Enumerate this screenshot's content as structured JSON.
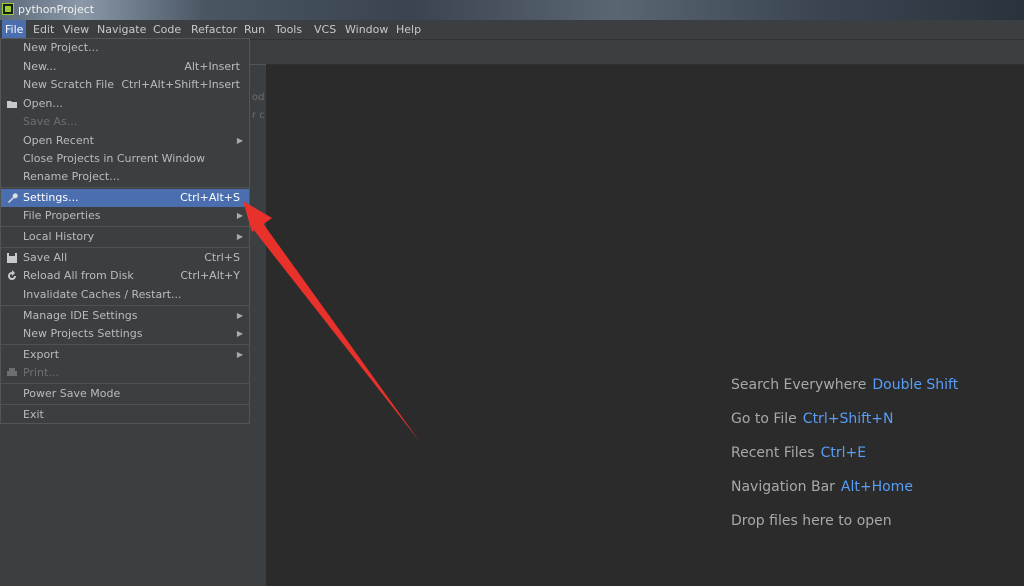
{
  "window": {
    "title": "pythonProject"
  },
  "menubar": [
    "File",
    "Edit",
    "View",
    "Navigate",
    "Code",
    "Refactor",
    "Run",
    "Tools",
    "VCS",
    "Window",
    "Help"
  ],
  "side_fragments": [
    "od",
    "r c"
  ],
  "file_menu": {
    "items": [
      {
        "label": "New Project...",
        "shortcut": ""
      },
      {
        "label": "New...",
        "shortcut": "Alt+Insert"
      },
      {
        "label": "New Scratch File",
        "shortcut": "Ctrl+Alt+Shift+Insert"
      },
      {
        "label": "Open...",
        "shortcut": ""
      },
      {
        "label": "Save As...",
        "shortcut": ""
      },
      {
        "label": "Open Recent",
        "shortcut": ""
      },
      {
        "label": "Close Projects in Current Window",
        "shortcut": ""
      },
      {
        "label": "Rename Project...",
        "shortcut": ""
      },
      {
        "label": "Settings...",
        "shortcut": "Ctrl+Alt+S"
      },
      {
        "label": "File Properties",
        "shortcut": ""
      },
      {
        "label": "Local History",
        "shortcut": ""
      },
      {
        "label": "Save All",
        "shortcut": "Ctrl+S"
      },
      {
        "label": "Reload All from Disk",
        "shortcut": "Ctrl+Alt+Y"
      },
      {
        "label": "Invalidate Caches / Restart...",
        "shortcut": ""
      },
      {
        "label": "Manage IDE Settings",
        "shortcut": ""
      },
      {
        "label": "New Projects Settings",
        "shortcut": ""
      },
      {
        "label": "Export",
        "shortcut": ""
      },
      {
        "label": "Print...",
        "shortcut": ""
      },
      {
        "label": "Power Save Mode",
        "shortcut": ""
      },
      {
        "label": "Exit",
        "shortcut": ""
      }
    ]
  },
  "hints": [
    {
      "label": "Search Everywhere",
      "key": "Double Shift"
    },
    {
      "label": "Go to File",
      "key": "Ctrl+Shift+N"
    },
    {
      "label": "Recent Files",
      "key": "Ctrl+E"
    },
    {
      "label": "Navigation Bar",
      "key": "Alt+Home"
    },
    {
      "label": "Drop files here to open",
      "key": ""
    }
  ],
  "colors": {
    "accent": "#4b6eaf",
    "hint_key": "#589df6",
    "annotation_arrow": "#e8312b"
  }
}
